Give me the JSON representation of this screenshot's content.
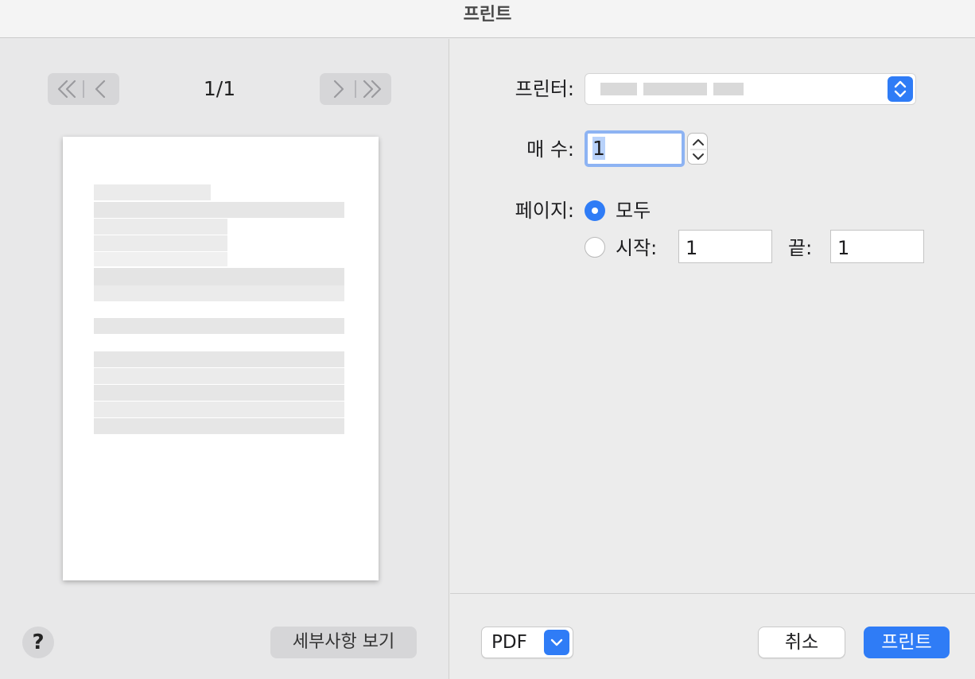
{
  "window": {
    "title": "프린트"
  },
  "preview": {
    "page_indicator": "1/1",
    "nav_first_icon": "double-chevron-left-icon",
    "nav_prev_icon": "chevron-left-icon",
    "nav_next_icon": "chevron-right-icon",
    "nav_last_icon": "double-chevron-right-icon"
  },
  "settings": {
    "printer_label": "프린터:",
    "copies_label": "매 수:",
    "copies_value": "1",
    "pages_label": "페이지:",
    "pages_all_label": "모두",
    "pages_range_label": "시작:",
    "pages_from_value": "1",
    "pages_to_label": "끝:",
    "pages_to_value": "1",
    "pages_selected": "all"
  },
  "footer": {
    "help_label": "?",
    "details_label": "세부사항 보기",
    "pdf_label": "PDF",
    "cancel_label": "취소",
    "print_label": "프린트"
  },
  "colors": {
    "accent": "#2f7cf6",
    "focus_ring": "#8db3f3",
    "pane_background": "#ececec"
  }
}
